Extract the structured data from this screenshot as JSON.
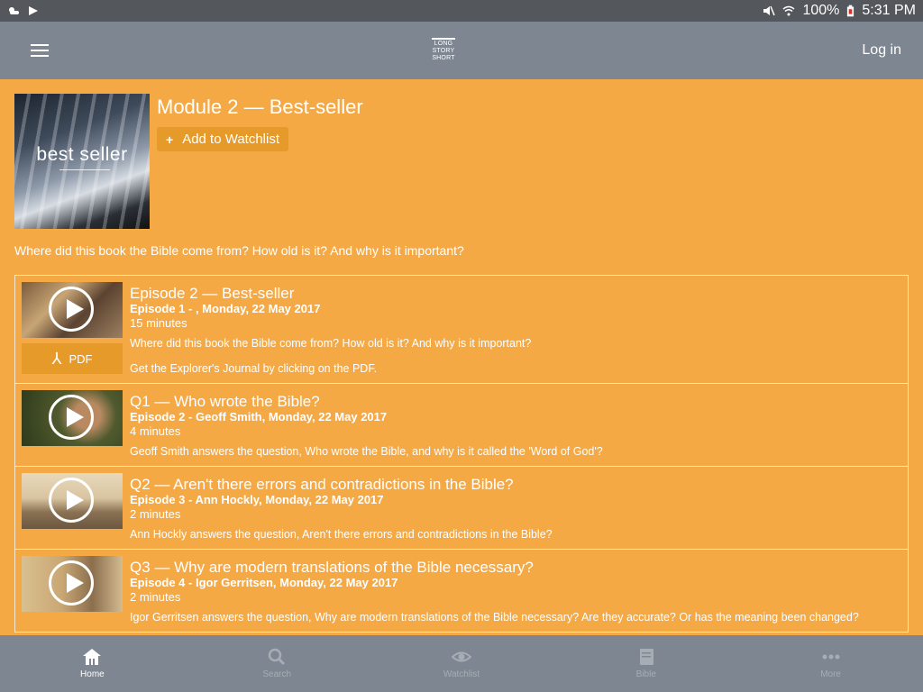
{
  "status_bar": {
    "battery": "100%",
    "time": "5:31 PM",
    "icons": [
      "weather-icon",
      "play-store-icon",
      "mute-icon",
      "wifi-icon",
      "battery-icon"
    ]
  },
  "app_bar": {
    "logo_lines": [
      "LONG",
      "STORY",
      "SHORT"
    ],
    "login_label": "Log in"
  },
  "module": {
    "cover_text": "best seller",
    "title": "Module 2 — Best-seller",
    "watchlist_label": "Add to Watchlist",
    "description": "Where did this book the Bible come from? How old is it? And why is it important?"
  },
  "episodes": [
    {
      "title": "Episode 2 — Best-seller",
      "meta": "Episode 1 - , Monday, 22 May 2017",
      "duration": "15 minutes",
      "description": "Where did this book the Bible come from? How old is it? And why is it important?",
      "pdf_label": "PDF",
      "journal_note": "Get the Explorer's Journal by clicking on the PDF."
    },
    {
      "title": "Q1 — Who wrote the Bible?",
      "meta": "Episode 2 - Geoff Smith, Monday, 22 May 2017",
      "duration": "4 minutes",
      "description": "Geoff Smith answers the question, Who wrote the Bible, and why is it called the 'Word of God'?"
    },
    {
      "title": "Q2 — Aren't there errors and contradictions in the Bible?",
      "meta": "Episode 3 - Ann Hockly, Monday, 22 May 2017",
      "duration": "2 minutes",
      "description": "Ann Hockly answers the question, Aren't there errors and contradictions in the Bible?"
    },
    {
      "title": "Q3 — Why are modern translations of the Bible necessary?",
      "meta": "Episode 4 - Igor Gerritsen, Monday, 22 May 2017",
      "duration": "2 minutes",
      "description": "Igor Gerritsen answers the question, Why are modern translations of the Bible necessary? Are they accurate? Or has the meaning been changed?"
    }
  ],
  "bottom_nav": [
    {
      "label": "Home",
      "icon": "home-icon",
      "active": true
    },
    {
      "label": "Search",
      "icon": "search-icon",
      "active": false
    },
    {
      "label": "Watchlist",
      "icon": "eye-icon",
      "active": false
    },
    {
      "label": "Bible",
      "icon": "book-icon",
      "active": false
    },
    {
      "label": "More",
      "icon": "more-dots-icon",
      "active": false
    }
  ]
}
